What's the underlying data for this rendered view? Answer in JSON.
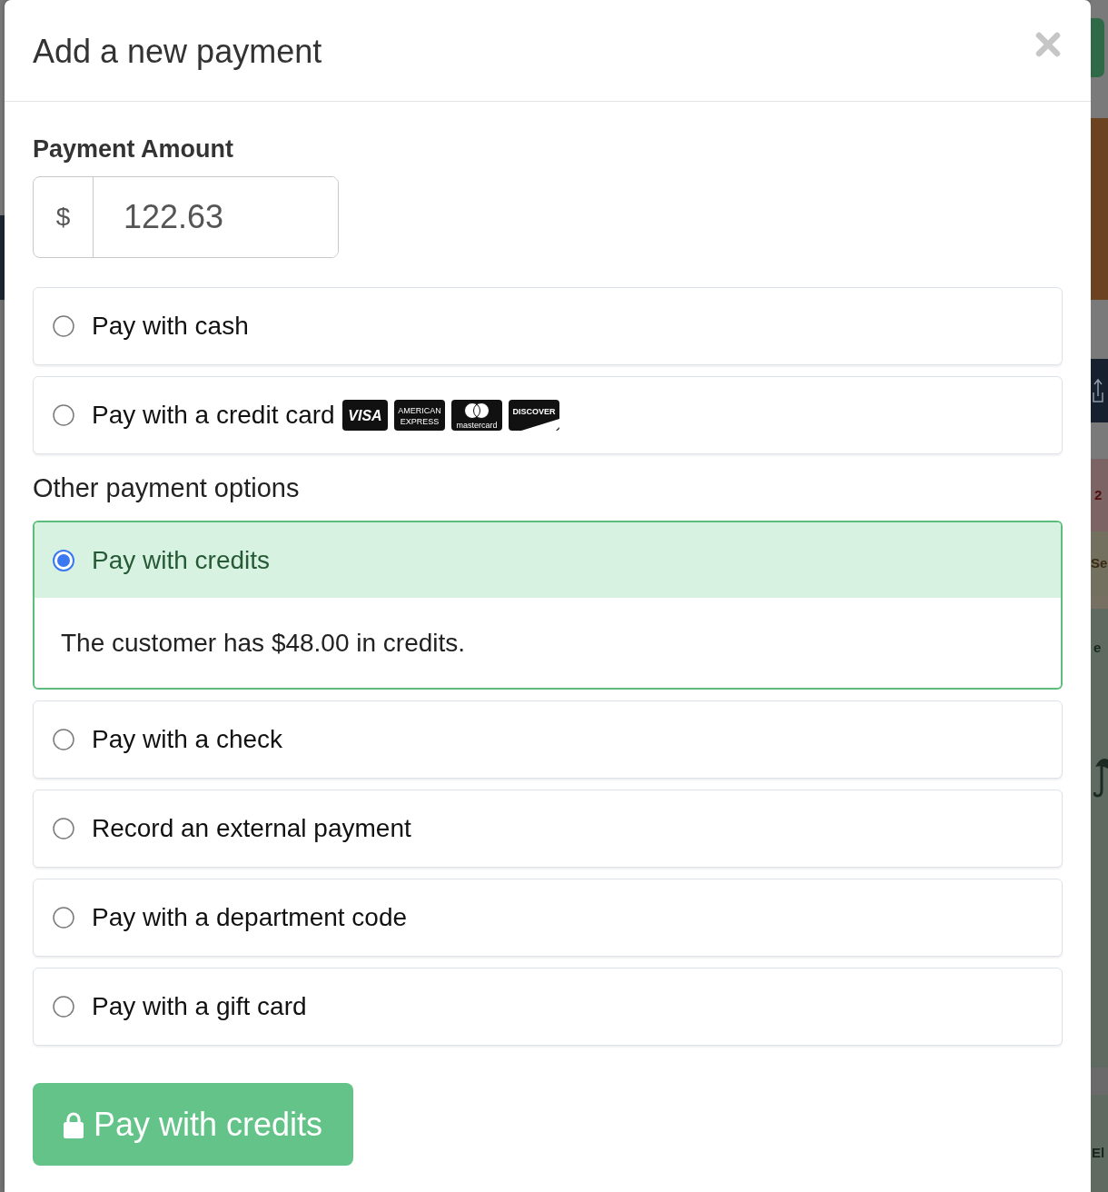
{
  "modal": {
    "title": "Add a new payment"
  },
  "amount": {
    "label": "Payment Amount",
    "prefix": "$",
    "value": "122.63"
  },
  "payment_methods": [
    {
      "label": "Pay with cash",
      "selected": false
    },
    {
      "label": "Pay with a credit card",
      "selected": false,
      "card_logos": [
        {
          "kind": "visa",
          "texts": [
            "VISA"
          ]
        },
        {
          "kind": "amex",
          "texts": [
            "AMERICAN",
            "EXPRESS"
          ]
        },
        {
          "kind": "mastercard",
          "texts": [
            "mastercard"
          ]
        },
        {
          "kind": "discover",
          "texts": [
            "DISCOVER"
          ]
        }
      ]
    }
  ],
  "other_options": {
    "heading": "Other payment options",
    "items": [
      {
        "label": "Pay with credits",
        "selected": true,
        "detail": "The customer has $48.00 in credits."
      },
      {
        "label": "Pay with a check",
        "selected": false
      },
      {
        "label": "Record an external payment",
        "selected": false
      },
      {
        "label": "Pay with a department code",
        "selected": false
      },
      {
        "label": "Pay with a gift card",
        "selected": false
      }
    ]
  },
  "submit_button": {
    "label": "Pay with credits"
  },
  "background_page": {
    "texts": [
      "2",
      "Se",
      "e",
      "El"
    ]
  }
}
